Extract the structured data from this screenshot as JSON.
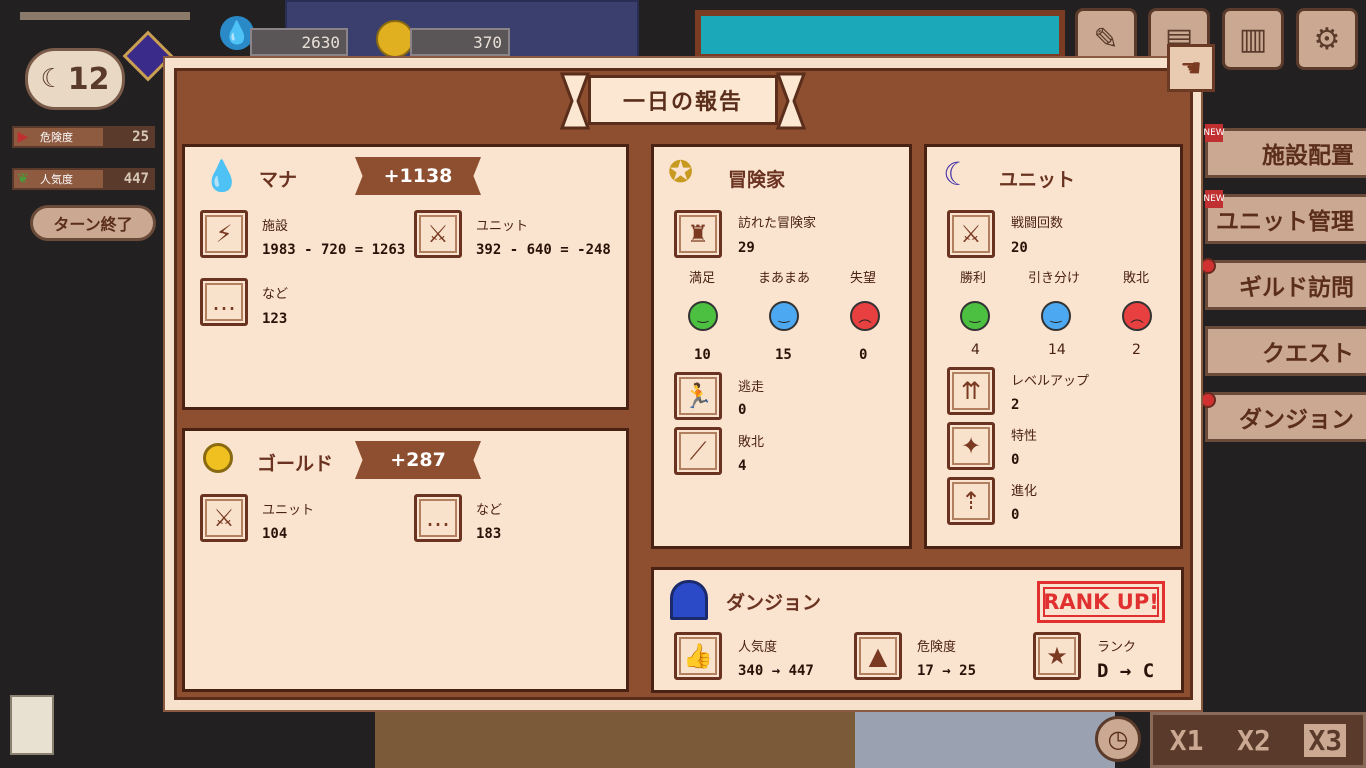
{
  "hud": {
    "day": "12",
    "danger_label": "危険度",
    "danger_value": "25",
    "popularity_label": "人気度",
    "popularity_value": "447",
    "end_turn": "ターン終了",
    "mana_total": "2630",
    "gold_total": "370"
  },
  "side_menu": [
    {
      "label": "施設配置",
      "new": "NEW"
    },
    {
      "label": "ユニット管理",
      "new": "NEW"
    },
    {
      "label": "ギルド訪問"
    },
    {
      "label": "クエスト"
    },
    {
      "label": "ダンジョン"
    }
  ],
  "speed": [
    "X1",
    "X2",
    "X3"
  ],
  "icons": {
    "close": "close-hand-icon",
    "stats": "bar-chart-icon",
    "settings": "gear-icon"
  },
  "report": {
    "title": "一日の報告",
    "mana": {
      "title": "マナ",
      "total": "+1138",
      "facility_label": "施設",
      "facility_value": "1983 - 720 = 1263",
      "unit_label": "ユニット",
      "unit_value": "392 - 640 = -248",
      "other_label": "など",
      "other_value": "123"
    },
    "gold": {
      "title": "ゴールド",
      "total": "+287",
      "unit_label": "ユニット",
      "unit_value": "104",
      "other_label": "など",
      "other_value": "183"
    },
    "adventurer": {
      "title": "冒険家",
      "visited_label": "訪れた冒険家",
      "visited_value": "29",
      "satisfied_label": "満足",
      "satisfied_value": "10",
      "so_so_label": "まあまあ",
      "so_so_value": "15",
      "disappointed_label": "失望",
      "disappointed_value": "0",
      "escape_label": "逃走",
      "escape_value": "0",
      "defeat_label": "敗北",
      "defeat_value": "4"
    },
    "unit": {
      "title": "ユニット",
      "battles_label": "戦闘回数",
      "battles_value": "20",
      "win_label": "勝利",
      "win_value": "4",
      "draw_label": "引き分け",
      "draw_value": "14",
      "lose_label": "敗北",
      "lose_value": "2",
      "levelup_label": "レベルアップ",
      "levelup_value": "2",
      "trait_label": "特性",
      "trait_value": "0",
      "evolve_label": "進化",
      "evolve_value": "0"
    },
    "dungeon": {
      "title": "ダンジョン",
      "rank_up": "RANK UP!",
      "popularity_label": "人気度",
      "popularity_value": "340 → 447",
      "danger_label": "危険度",
      "danger_value": "17 → 25",
      "rank_label": "ランク",
      "rank_value": "D → C"
    }
  }
}
